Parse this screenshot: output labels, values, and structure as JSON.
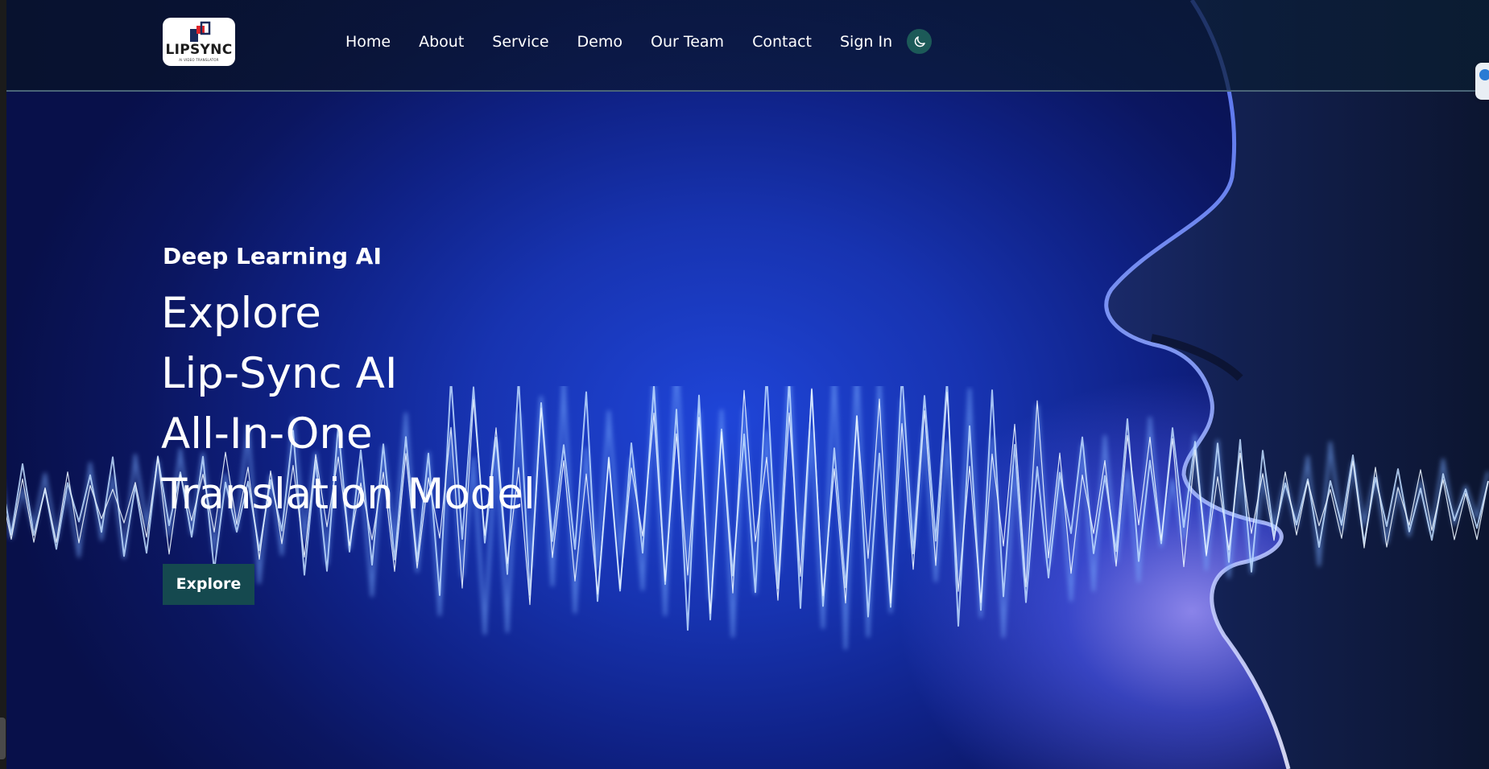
{
  "brand": {
    "logo_text": "LIPSYNC",
    "logo_subtext": "AI VIDEO TRANSLATOR",
    "colors": {
      "logo_red": "#e0242a",
      "logo_navy": "#1a2a5a"
    }
  },
  "nav": {
    "items": [
      {
        "label": "Home"
      },
      {
        "label": "About"
      },
      {
        "label": "Service"
      },
      {
        "label": "Demo"
      },
      {
        "label": "Our Team"
      },
      {
        "label": "Contact"
      },
      {
        "label": "Sign In"
      }
    ],
    "theme_toggle_icon": "moon-icon"
  },
  "hero": {
    "eyebrow": "Deep Learning AI",
    "headline_lines": [
      "Explore",
      "Lip-Sync AI",
      "All-In-One",
      "Translation Model"
    ],
    "cta_label": "Explore",
    "background": "sound-wave and face silhouette"
  },
  "colors": {
    "accent": "#15494f",
    "toggle_bg": "#1c5a58",
    "hero_blue": "#1f45d8"
  }
}
